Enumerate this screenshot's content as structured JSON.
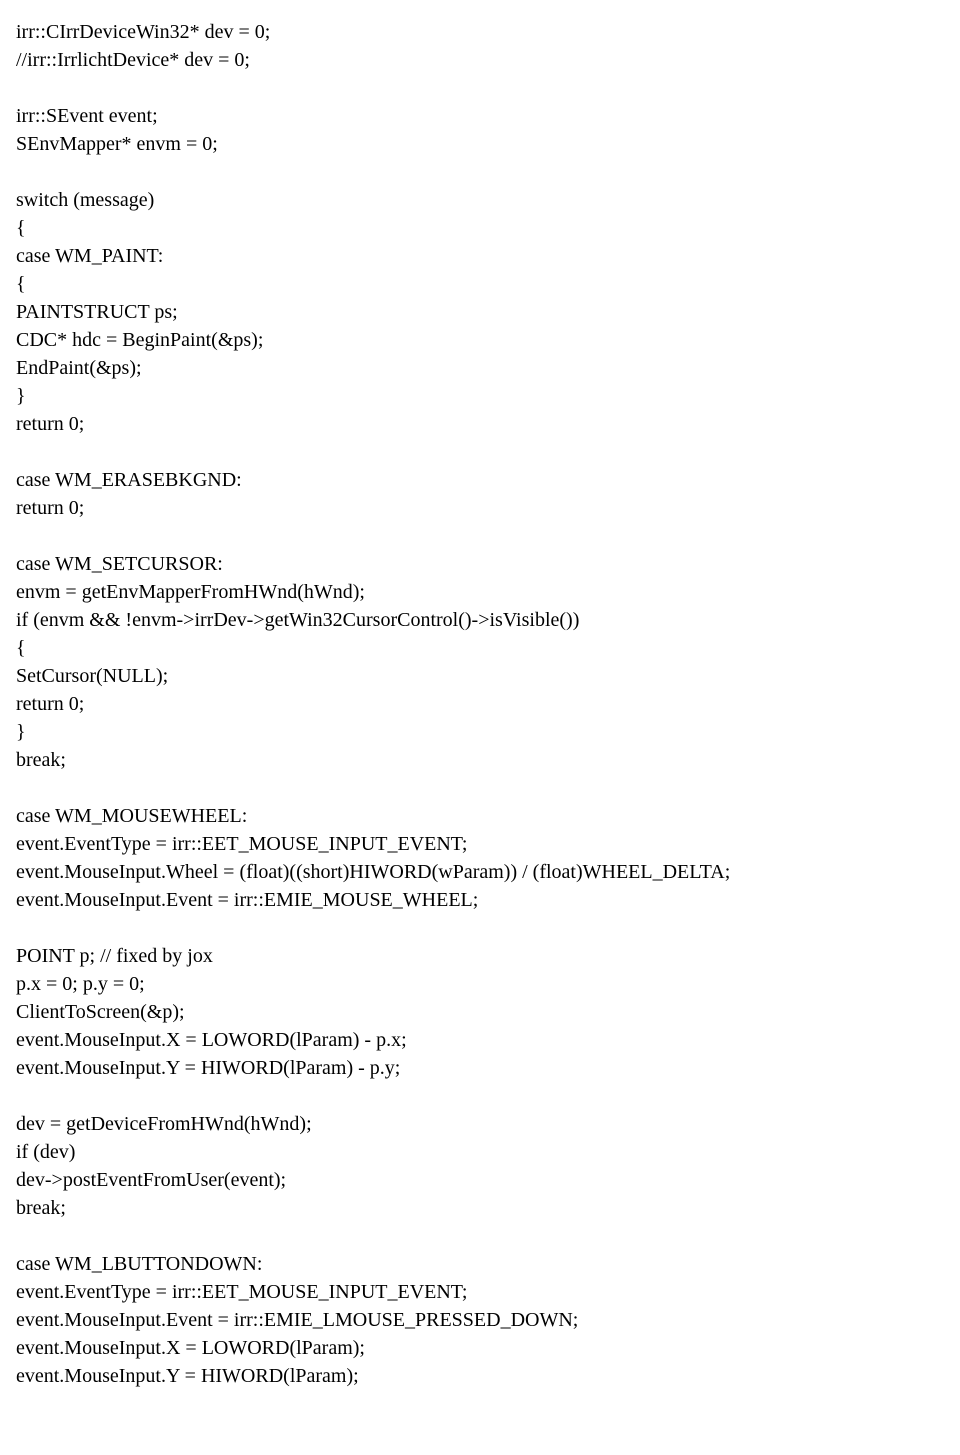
{
  "lines": [
    "irr::CIrrDeviceWin32* dev = 0;",
    "//irr::IrrlichtDevice* dev = 0;",
    "",
    "irr::SEvent event;",
    "SEnvMapper* envm = 0;",
    "",
    "switch (message)",
    "{",
    "case WM_PAINT:",
    "{",
    "PAINTSTRUCT ps;",
    "CDC* hdc = BeginPaint(&ps);",
    "EndPaint(&ps);",
    "}",
    "return 0;",
    "",
    "case WM_ERASEBKGND:",
    "return 0;",
    "",
    "case WM_SETCURSOR:",
    "envm = getEnvMapperFromHWnd(hWnd);",
    "if (envm && !envm->irrDev->getWin32CursorControl()->isVisible())",
    "{",
    "SetCursor(NULL);",
    "return 0;",
    "}",
    "break;",
    "",
    "case WM_MOUSEWHEEL:",
    "event.EventType = irr::EET_MOUSE_INPUT_EVENT;",
    "event.MouseInput.Wheel = (float)((short)HIWORD(wParam)) / (float)WHEEL_DELTA;",
    "event.MouseInput.Event = irr::EMIE_MOUSE_WHEEL;",
    "",
    "POINT p; // fixed by jox",
    "p.x = 0; p.y = 0;",
    "ClientToScreen(&p);",
    "event.MouseInput.X = LOWORD(lParam) - p.x;",
    "event.MouseInput.Y = HIWORD(lParam) - p.y;",
    "",
    "dev = getDeviceFromHWnd(hWnd);",
    "if (dev)",
    "dev->postEventFromUser(event);",
    "break;",
    "",
    "case WM_LBUTTONDOWN:",
    "event.EventType = irr::EET_MOUSE_INPUT_EVENT;",
    "event.MouseInput.Event = irr::EMIE_LMOUSE_PRESSED_DOWN;",
    "event.MouseInput.X = LOWORD(lParam);",
    "event.MouseInput.Y = HIWORD(lParam);"
  ]
}
